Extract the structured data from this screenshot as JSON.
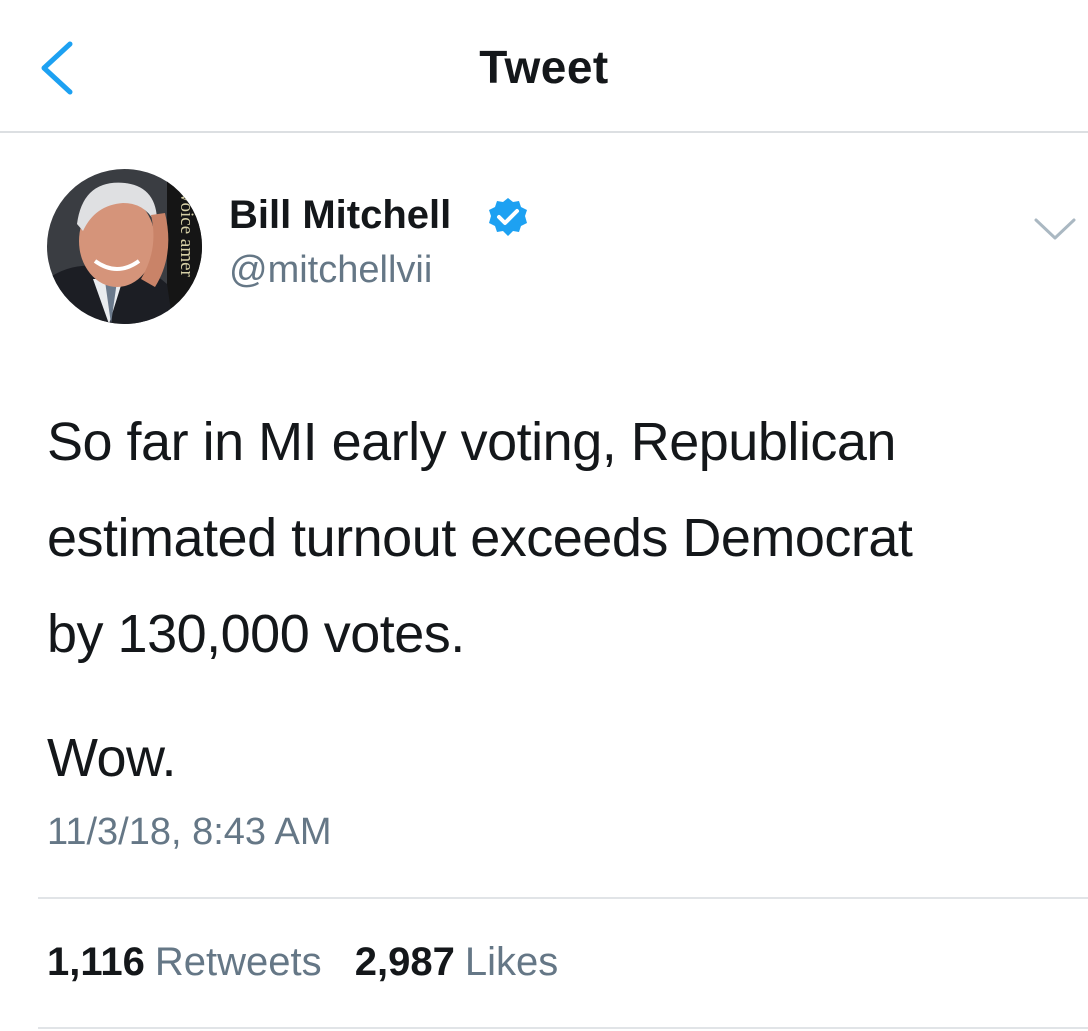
{
  "nav": {
    "title": "Tweet"
  },
  "colors": {
    "accent": "#1da1f2",
    "text": "#14171a",
    "muted": "#657786",
    "divider": "#e1e4e7"
  },
  "author": {
    "name": "Bill Mitchell",
    "handle": "@mitchellvii",
    "avatar_watermark": "voice amer",
    "verified": true
  },
  "tweet": {
    "lines": [
      "So far in MI early voting, Republican",
      "estimated turnout exceeds Democrat",
      "by 130,000 votes."
    ],
    "closing": "Wow.",
    "timestamp": "11/3/18, 8:43 AM"
  },
  "stats": {
    "retweets_count": "1,116",
    "retweets_label": "Retweets",
    "likes_count": "2,987",
    "likes_label": "Likes"
  },
  "icons": {
    "back": "chevron-left-icon",
    "verified": "verified-badge-icon",
    "more": "chevron-down-icon"
  }
}
